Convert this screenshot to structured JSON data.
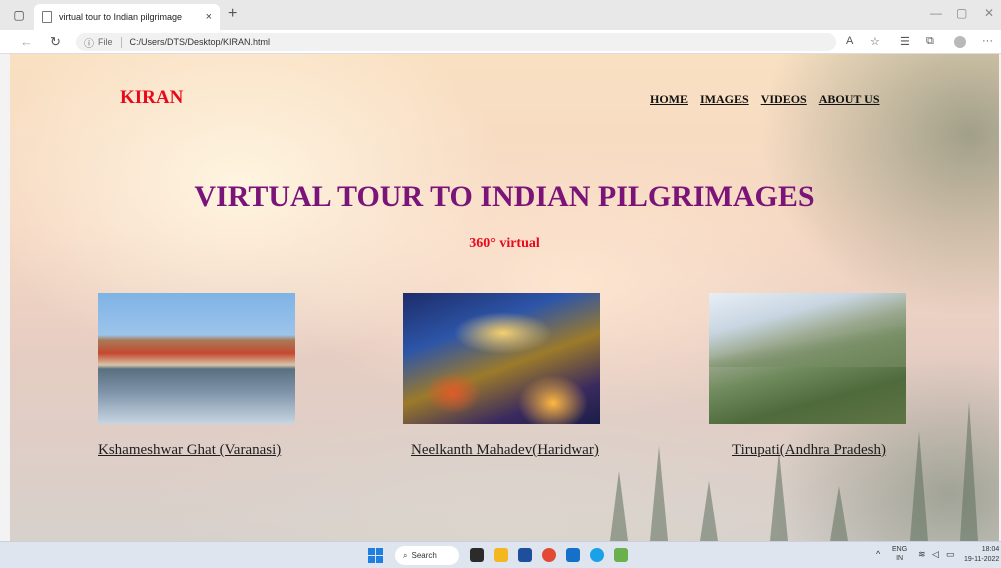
{
  "browser": {
    "tab_title": "virtual tour to Indian pilgrimage",
    "tab_close": "×",
    "new_tab": "+",
    "url_scheme_label": "File",
    "url": "C:/Users/DTS/Desktop/KIRAN.html"
  },
  "page": {
    "brand": "KIRAN",
    "nav": [
      "HOME",
      "IMAGES",
      "VIDEOS",
      "ABOUT US"
    ],
    "headline": "VIRTUAL TOUR TO INDIAN PILGRIMAGES",
    "subheadline": "360° virtual",
    "places": [
      {
        "caption": "Kshameshwar Ghat (Varanasi)"
      },
      {
        "caption": "Neelkanth Mahadev(Haridwar)"
      },
      {
        "caption": "Tirupati(Andhra Pradesh)"
      }
    ],
    "colors": {
      "brand": "#e8081a",
      "headline": "#7a1479",
      "subheadline": "#e8081a"
    }
  },
  "taskbar": {
    "search_label": "Search",
    "lang": "ENG",
    "region": "IN",
    "time": "18:04",
    "date": "19-11-2022"
  }
}
